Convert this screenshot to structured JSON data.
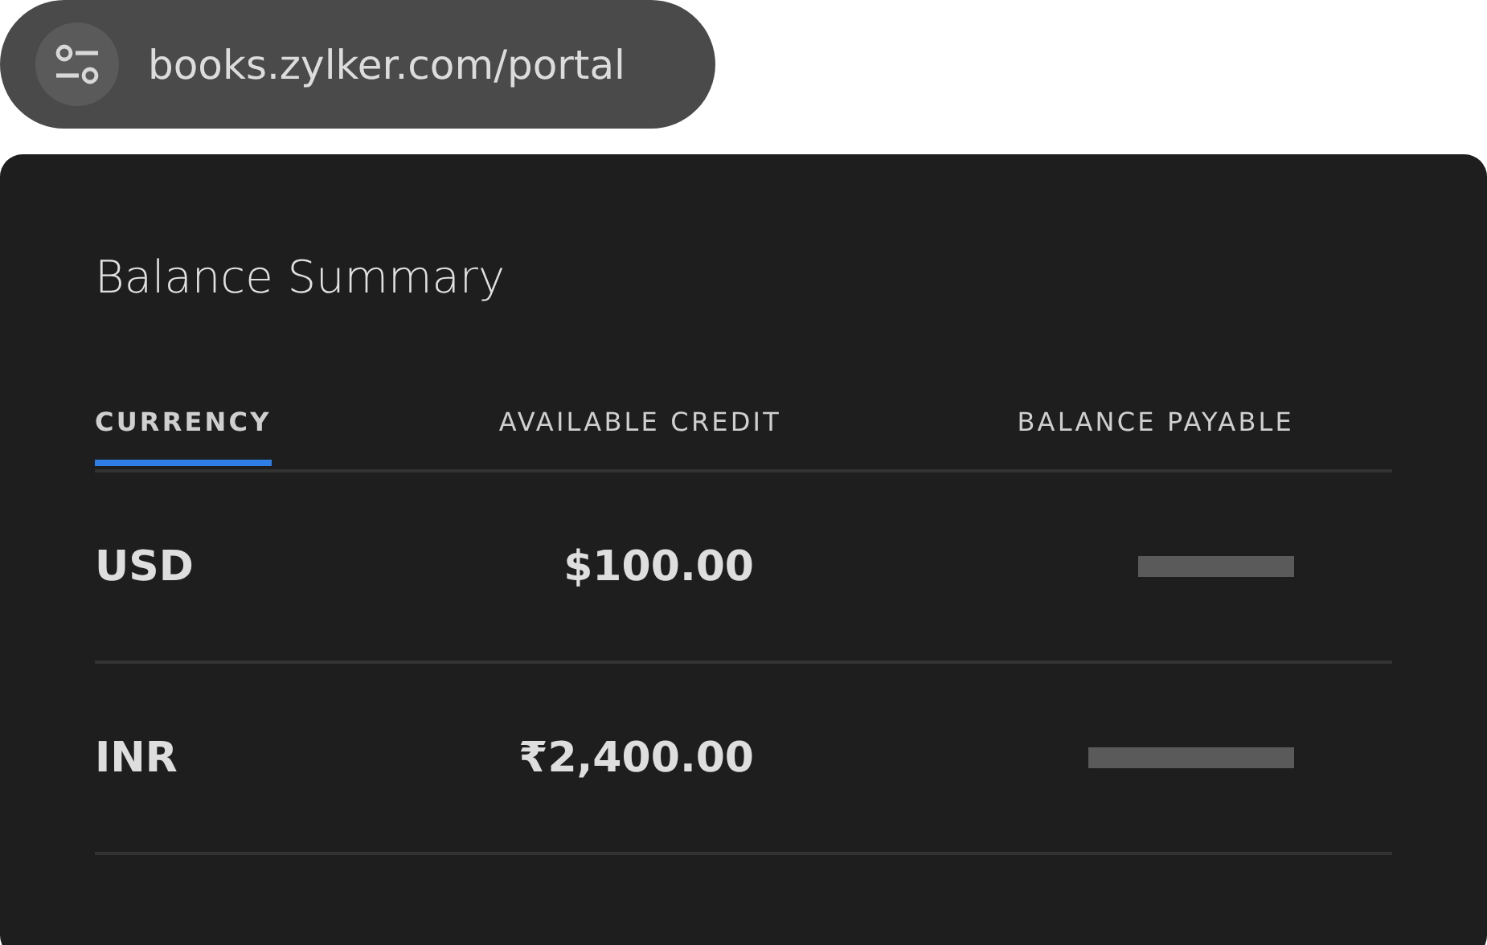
{
  "address_bar": {
    "url": "books.zylker.com/portal"
  },
  "card": {
    "title": "Balance Summary",
    "columns": [
      {
        "label": "CURRENCY",
        "selected": true
      },
      {
        "label": "AVAILABLE CREDIT",
        "selected": false
      },
      {
        "label": "BALANCE PAYABLE",
        "selected": false
      }
    ],
    "rows": [
      {
        "currency": "USD",
        "available_credit": "$100.00"
      },
      {
        "currency": "INR",
        "available_credit": "₹2,400.00"
      }
    ]
  }
}
